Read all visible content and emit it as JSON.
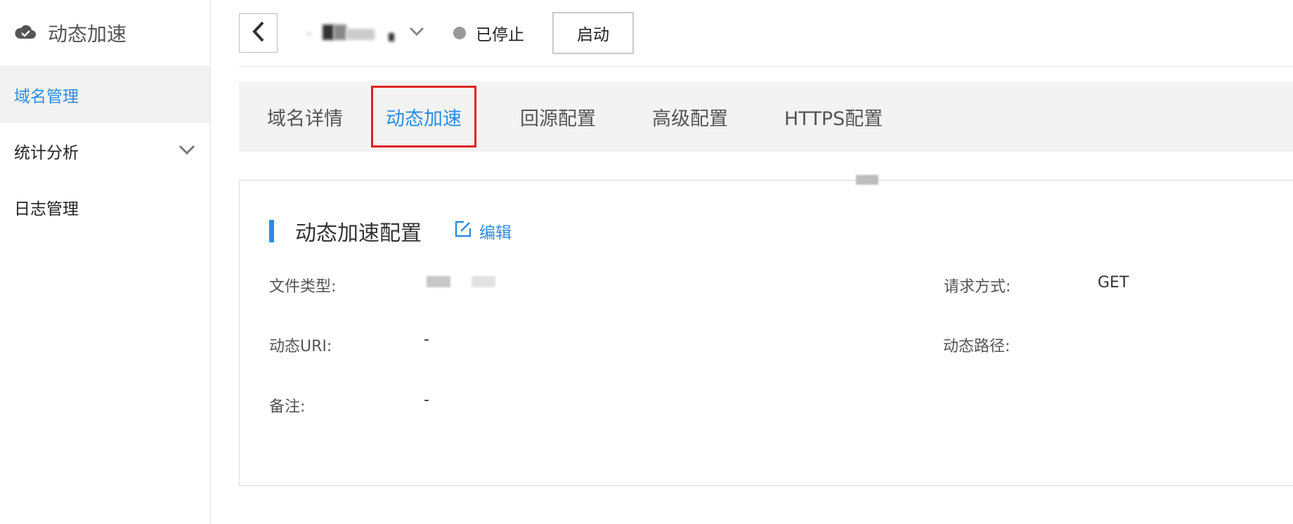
{
  "sidebar": {
    "title": "动态加速",
    "items": [
      {
        "label": "域名管理",
        "active": true
      },
      {
        "label": "统计分析",
        "active": false,
        "expandable": true
      },
      {
        "label": "日志管理",
        "active": false
      }
    ]
  },
  "topbar": {
    "status": "已停止",
    "start_label": "启动"
  },
  "tabs": [
    {
      "label": "域名详情"
    },
    {
      "label": "动态加速",
      "active": true
    },
    {
      "label": "回源配置"
    },
    {
      "label": "高级配置"
    },
    {
      "label": "HTTPS配置"
    }
  ],
  "config": {
    "title": "动态加速配置",
    "edit_label": "编辑",
    "fields": {
      "file_type_label": "文件类型:",
      "request_method_label": "请求方式:",
      "request_method_value": "GET",
      "dynamic_uri_label": "动态URI:",
      "dynamic_uri_value": "-",
      "dynamic_path_label": "动态路径:",
      "remark_label": "备注:",
      "remark_value": "-"
    }
  },
  "colors": {
    "accent": "#2a8ce6",
    "highlight_border": "#e0241c",
    "status_dot": "#999999"
  }
}
